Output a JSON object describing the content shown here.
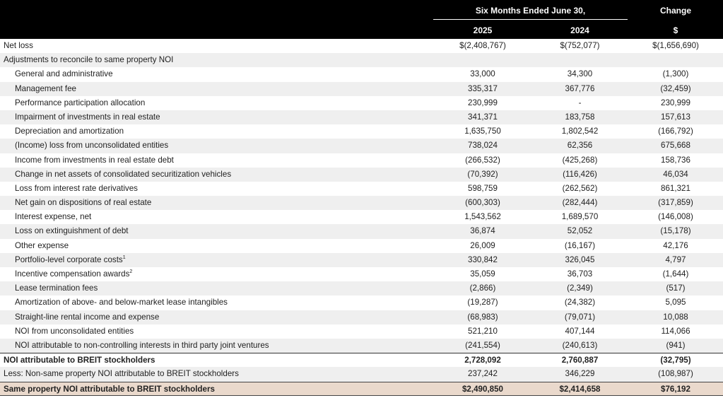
{
  "header": {
    "period": "Six Months Ended June 30,",
    "change": "Change",
    "year1": "2025",
    "year2": "2024",
    "change_unit": "$"
  },
  "rows": [
    {
      "label": "Net loss",
      "sup": "",
      "v2025": "$(2,408,767)",
      "v2024": "$(752,077)",
      "change": "$(1,656,690)",
      "style": "plain",
      "indent": false
    },
    {
      "label": "Adjustments to reconcile to same property NOI",
      "sup": "",
      "v2025": "",
      "v2024": "",
      "change": "",
      "style": "alt",
      "indent": false
    },
    {
      "label": "General and administrative",
      "sup": "",
      "v2025": "33,000",
      "v2024": "34,300",
      "change": "(1,300)",
      "style": "plain",
      "indent": true
    },
    {
      "label": "Management fee",
      "sup": "",
      "v2025": "335,317",
      "v2024": "367,776",
      "change": "(32,459)",
      "style": "alt",
      "indent": true
    },
    {
      "label": "Performance participation allocation",
      "sup": "",
      "v2025": "230,999",
      "v2024": "-",
      "change": "230,999",
      "style": "plain",
      "indent": true
    },
    {
      "label": "Impairment of investments in real estate",
      "sup": "",
      "v2025": "341,371",
      "v2024": "183,758",
      "change": "157,613",
      "style": "alt",
      "indent": true
    },
    {
      "label": "Depreciation and amortization",
      "sup": "",
      "v2025": "1,635,750",
      "v2024": "1,802,542",
      "change": "(166,792)",
      "style": "plain",
      "indent": true
    },
    {
      "label": "(Income) loss from unconsolidated entities",
      "sup": "",
      "v2025": "738,024",
      "v2024": "62,356",
      "change": "675,668",
      "style": "alt",
      "indent": true
    },
    {
      "label": "Income from investments in real estate debt",
      "sup": "",
      "v2025": "(266,532)",
      "v2024": "(425,268)",
      "change": "158,736",
      "style": "plain",
      "indent": true
    },
    {
      "label": "Change in net assets of consolidated securitization vehicles",
      "sup": "",
      "v2025": "(70,392)",
      "v2024": "(116,426)",
      "change": "46,034",
      "style": "alt",
      "indent": true
    },
    {
      "label": "Loss from interest rate derivatives",
      "sup": "",
      "v2025": "598,759",
      "v2024": "(262,562)",
      "change": "861,321",
      "style": "plain",
      "indent": true
    },
    {
      "label": "Net gain on dispositions of real estate",
      "sup": "",
      "v2025": "(600,303)",
      "v2024": "(282,444)",
      "change": "(317,859)",
      "style": "alt",
      "indent": true
    },
    {
      "label": "Interest expense, net",
      "sup": "",
      "v2025": "1,543,562",
      "v2024": "1,689,570",
      "change": "(146,008)",
      "style": "plain",
      "indent": true
    },
    {
      "label": "Loss on extinguishment of debt",
      "sup": "",
      "v2025": "36,874",
      "v2024": "52,052",
      "change": "(15,178)",
      "style": "alt",
      "indent": true
    },
    {
      "label": "Other expense",
      "sup": "",
      "v2025": "26,009",
      "v2024": "(16,167)",
      "change": "42,176",
      "style": "plain",
      "indent": true
    },
    {
      "label": "Portfolio-level corporate costs",
      "sup": "1",
      "v2025": "330,842",
      "v2024": "326,045",
      "change": "4,797",
      "style": "alt",
      "indent": true
    },
    {
      "label": "Incentive compensation awards",
      "sup": "2",
      "v2025": "35,059",
      "v2024": "36,703",
      "change": "(1,644)",
      "style": "plain",
      "indent": true
    },
    {
      "label": "Lease termination fees",
      "sup": "",
      "v2025": "(2,866)",
      "v2024": "(2,349)",
      "change": "(517)",
      "style": "alt",
      "indent": true
    },
    {
      "label": "Amortization of above- and below-market lease intangibles",
      "sup": "",
      "v2025": "(19,287)",
      "v2024": "(24,382)",
      "change": "5,095",
      "style": "plain",
      "indent": true
    },
    {
      "label": "Straight-line rental income and expense",
      "sup": "",
      "v2025": "(68,983)",
      "v2024": "(79,071)",
      "change": "10,088",
      "style": "alt",
      "indent": true
    },
    {
      "label": "NOI from unconsolidated entities",
      "sup": "",
      "v2025": "521,210",
      "v2024": "407,144",
      "change": "114,066",
      "style": "plain",
      "indent": true
    },
    {
      "label": "NOI attributable to non-controlling interests in third party joint ventures",
      "sup": "",
      "v2025": "(241,554)",
      "v2024": "(240,613)",
      "change": "(941)",
      "style": "alt",
      "indent": true
    },
    {
      "label": "NOI attributable to BREIT stockholders",
      "sup": "",
      "v2025": "2,728,092",
      "v2024": "2,760,887",
      "change": "(32,795)",
      "style": "total",
      "indent": false
    },
    {
      "label": "Less: Non-same property NOI attributable to BREIT stockholders",
      "sup": "",
      "v2025": "237,242",
      "v2024": "346,229",
      "change": "(108,987)",
      "style": "alt",
      "indent": false
    },
    {
      "label": "Same property NOI attributable to BREIT stockholders",
      "sup": "",
      "v2025": "$2,490,850",
      "v2024": "$2,414,658",
      "change": "$76,192",
      "style": "final",
      "indent": false
    }
  ]
}
